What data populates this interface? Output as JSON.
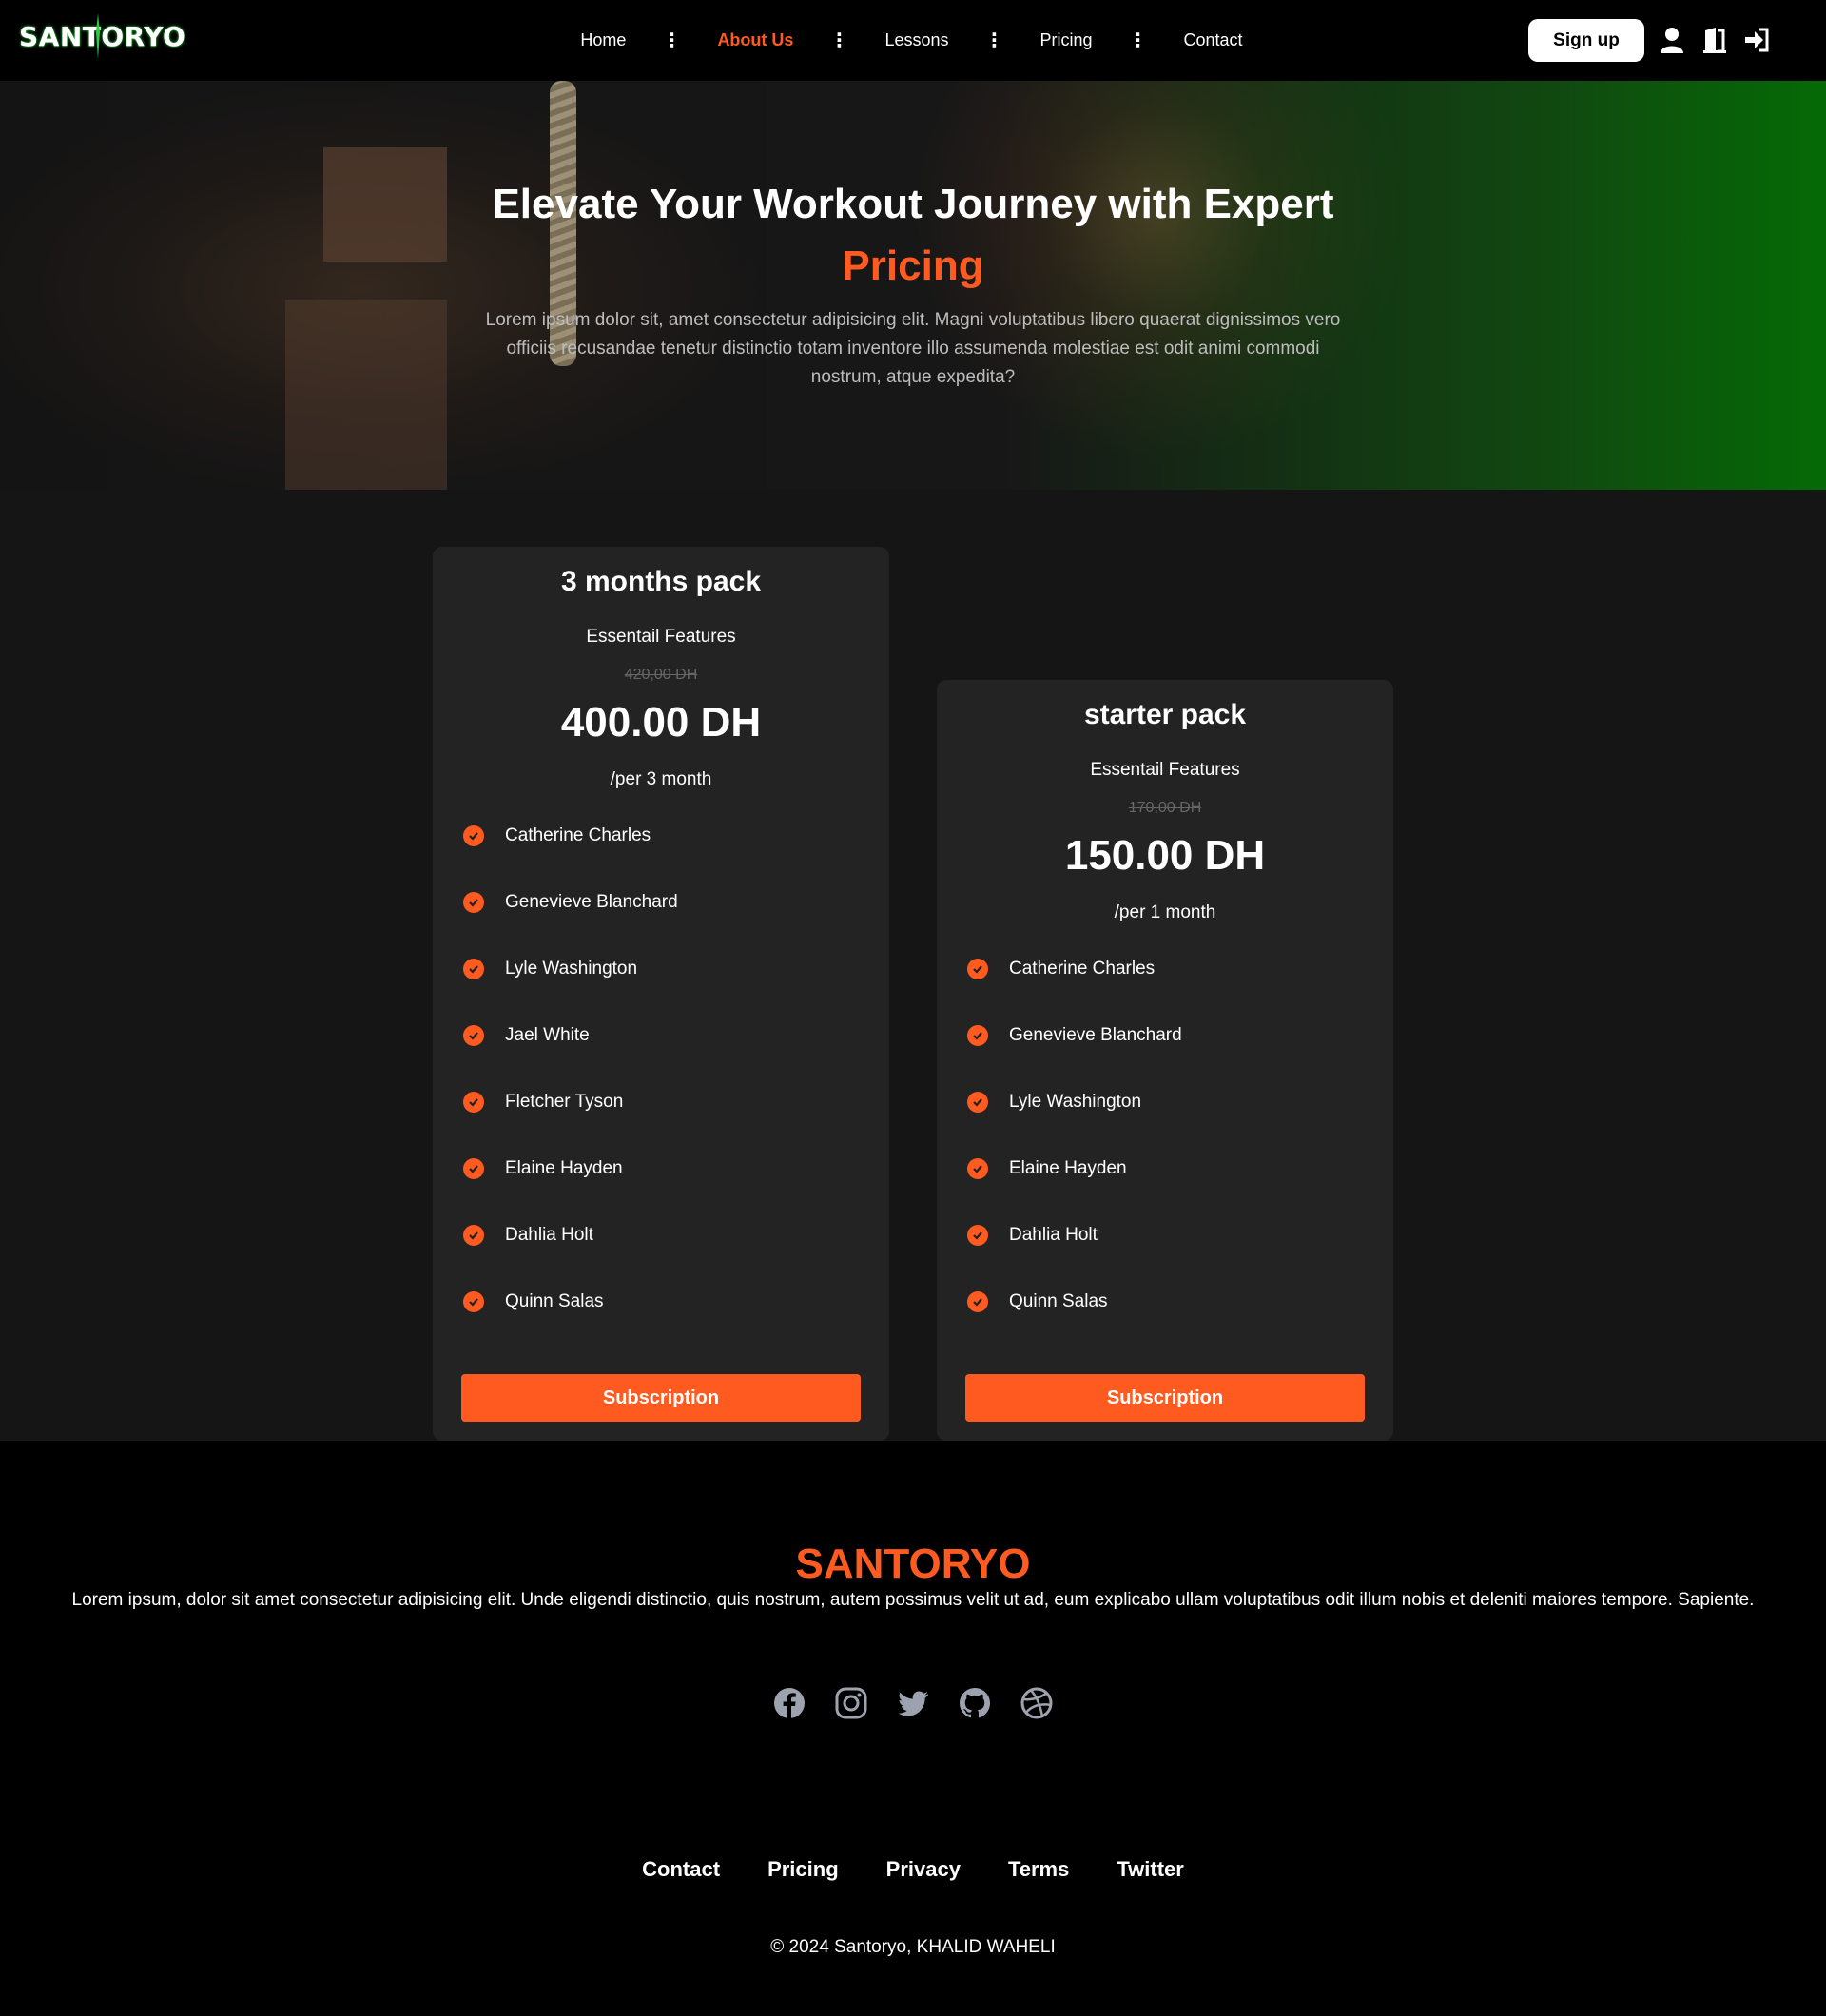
{
  "navbar": {
    "logo": "SANTORYO",
    "links": [
      "Home",
      "About Us",
      "Lessons",
      "Pricing",
      "Contact"
    ],
    "active_link": "About Us",
    "signup_label": "Sign up",
    "icons": [
      "user-icon",
      "door-icon",
      "login-icon"
    ]
  },
  "hero": {
    "title": "Elevate Your Workout Journey with Expert",
    "accent": "Pricing",
    "description": "Lorem ipsum dolor sit, amet consectetur adipisicing elit. Magni voluptatibus libero quaerat dignissimos vero officiis recusandae tenetur distinctio totam inventore illo assumenda molestiae est odit animi commodi nostrum, atque expedita?"
  },
  "plans": [
    {
      "name": "3 months pack",
      "subtitle": "Essentail Features",
      "old_price": "420,00 DH",
      "price": "400.00 DH",
      "period": "/per 3 month",
      "features": [
        "Catherine Charles",
        "Genevieve Blanchard",
        "Lyle Washington",
        "Jael White",
        "Fletcher Tyson",
        "Elaine Hayden",
        "Dahlia Holt",
        "Quinn Salas"
      ],
      "button": "Subscription"
    },
    {
      "name": "starter pack",
      "subtitle": "Essentail Features",
      "old_price": "170,00 DH",
      "price": "150.00 DH",
      "period": "/per 1 month",
      "features": [
        "Catherine Charles",
        "Genevieve Blanchard",
        "Lyle Washington",
        "Elaine Hayden",
        "Dahlia Holt",
        "Quinn Salas"
      ],
      "button": "Subscription"
    }
  ],
  "footer": {
    "brand": "SANTORYO",
    "description": "Lorem ipsum, dolor sit amet consectetur adipisicing elit. Unde eligendi distinctio, quis nostrum, autem possimus velit ut ad, eum explicabo ullam voluptatibus odit illum nobis et deleniti maiores tempore. Sapiente.",
    "social": [
      "facebook-icon",
      "instagram-icon",
      "twitter-icon",
      "github-icon",
      "dribbble-icon"
    ],
    "links": [
      "Contact",
      "Pricing",
      "Privacy",
      "Terms",
      "Twitter"
    ],
    "copyright": "© 2024 Santoryo, KHALID WAHELI"
  },
  "colors": {
    "accent": "#ff5a1f",
    "card_bg": "#232323",
    "section_bg": "#151515"
  }
}
